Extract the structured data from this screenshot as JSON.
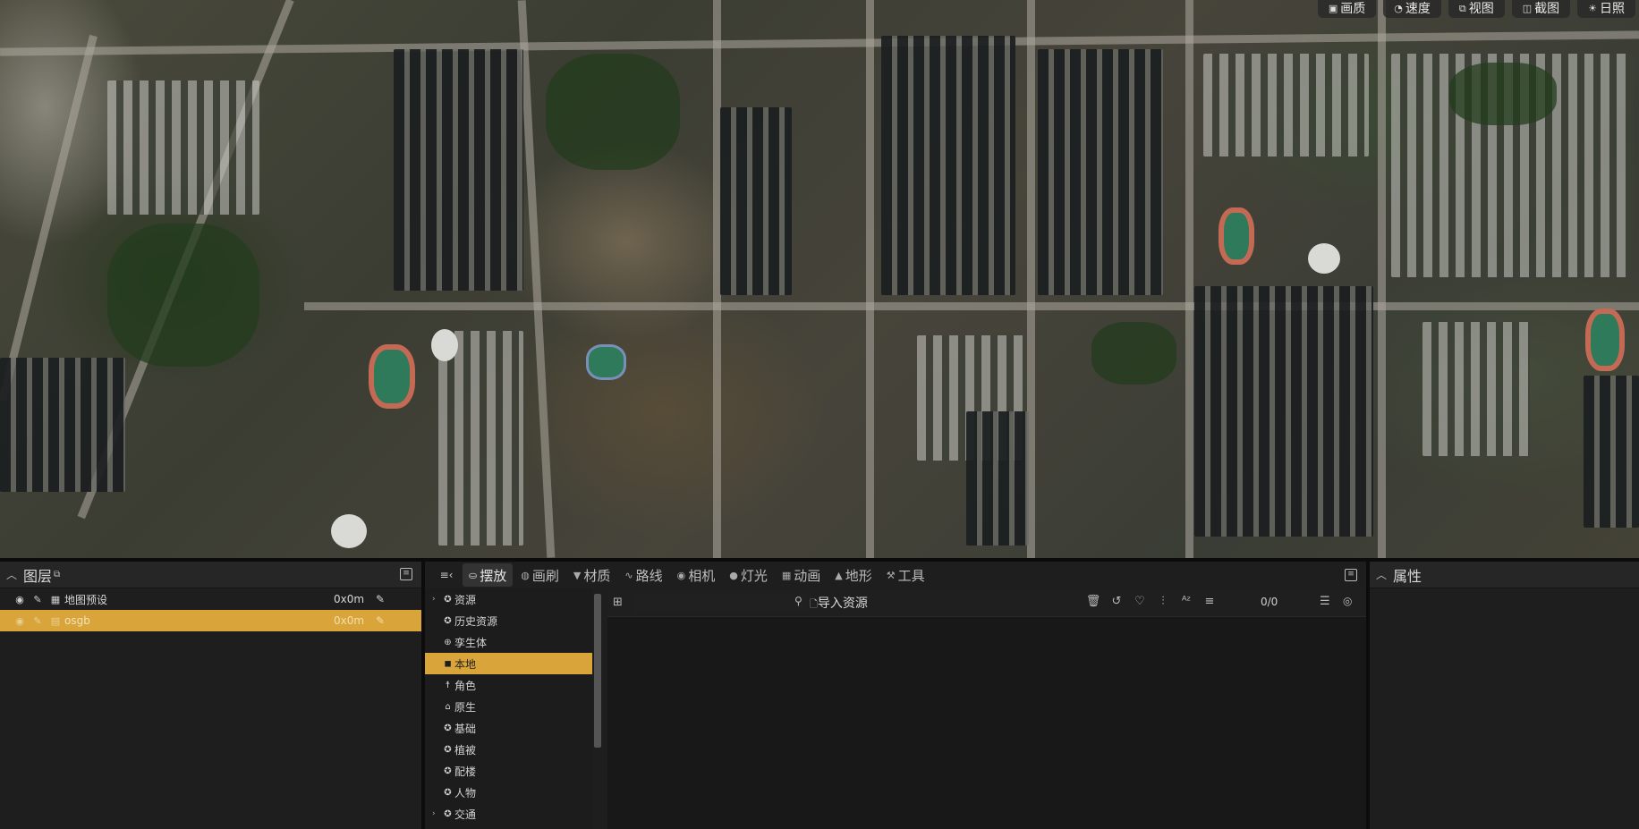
{
  "view_toolbar": [
    {
      "icon": "image-icon",
      "glyph": "▣",
      "label": "画质"
    },
    {
      "icon": "speedometer-icon",
      "glyph": "◔",
      "label": "速度"
    },
    {
      "icon": "camera-view-icon",
      "glyph": "⧉",
      "label": "视图"
    },
    {
      "icon": "screenshot-icon",
      "glyph": "◫",
      "label": "截图"
    },
    {
      "icon": "sun-icon",
      "glyph": "☀",
      "label": "日照"
    }
  ],
  "layers": {
    "title": "图层",
    "rows": [
      {
        "name": "地图预设",
        "size": "0x0m",
        "selected": false
      },
      {
        "name": "osgb",
        "size": "0x0m",
        "selected": true
      }
    ]
  },
  "placement": {
    "tabs": [
      {
        "icon": "box-icon",
        "glyph": "⛀",
        "label": "摆放",
        "active": true
      },
      {
        "icon": "brush-icon",
        "glyph": "◍",
        "label": "画刷",
        "active": false
      },
      {
        "icon": "material-icon",
        "glyph": "▼",
        "label": "材质",
        "active": false
      },
      {
        "icon": "route-icon",
        "glyph": "∿",
        "label": "路线",
        "active": false
      },
      {
        "icon": "camera-icon",
        "glyph": "◉",
        "label": "相机",
        "active": false
      },
      {
        "icon": "bulb-icon",
        "glyph": "●",
        "label": "灯光",
        "active": false
      },
      {
        "icon": "film-icon",
        "glyph": "▦",
        "label": "动画",
        "active": false
      },
      {
        "icon": "terrain-icon",
        "glyph": "▲",
        "label": "地形",
        "active": false
      },
      {
        "icon": "wrench-icon",
        "glyph": "⚒",
        "label": "工具",
        "active": false
      }
    ],
    "tree": [
      {
        "label": "资源",
        "has_arrow": true,
        "selected": false,
        "glyph": "✪"
      },
      {
        "label": "历史资源",
        "has_arrow": false,
        "selected": false,
        "glyph": "✪"
      },
      {
        "label": "孪生体",
        "has_arrow": false,
        "selected": false,
        "glyph": "⊕"
      },
      {
        "label": "本地",
        "has_arrow": false,
        "selected": true,
        "glyph": "◼"
      },
      {
        "label": "角色",
        "has_arrow": false,
        "selected": false,
        "glyph": "☨"
      },
      {
        "label": "原生",
        "has_arrow": false,
        "selected": false,
        "glyph": "⌂"
      },
      {
        "label": "基础",
        "has_arrow": false,
        "selected": false,
        "glyph": "✪"
      },
      {
        "label": "植被",
        "has_arrow": false,
        "selected": false,
        "glyph": "✪"
      },
      {
        "label": "配楼",
        "has_arrow": false,
        "selected": false,
        "glyph": "✪"
      },
      {
        "label": "人物",
        "has_arrow": false,
        "selected": false,
        "glyph": "✪"
      },
      {
        "label": "交通",
        "has_arrow": true,
        "selected": false,
        "glyph": "✪"
      }
    ],
    "search_placeholder": "",
    "import_label": "导入资源",
    "count": "0/0"
  },
  "properties": {
    "title": "属性"
  },
  "colors": {
    "accent": "#d9a53a",
    "panel_bg": "#1e1e1e"
  }
}
